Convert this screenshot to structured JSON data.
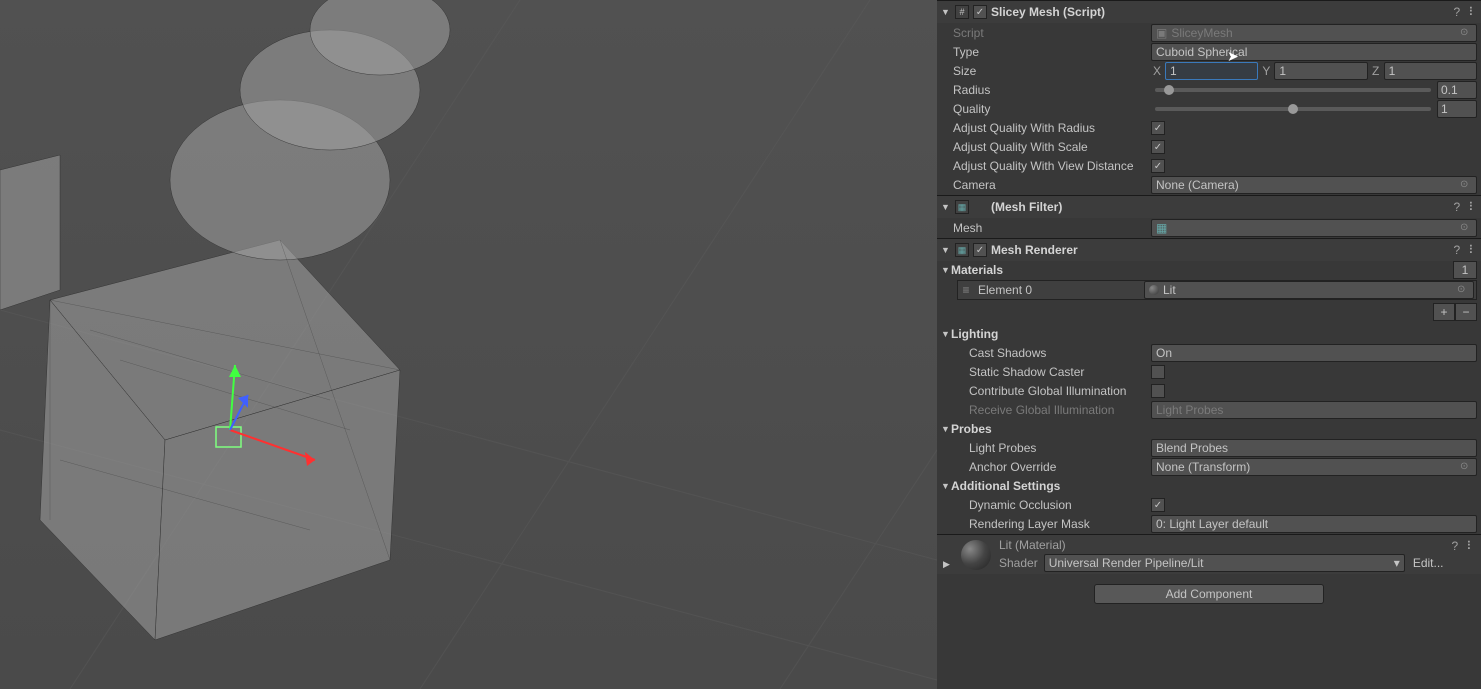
{
  "sliceyMesh": {
    "title": "Slicey Mesh (Script)",
    "scriptLabel": "Script",
    "scriptValue": "SliceyMesh",
    "typeLabel": "Type",
    "typeValue": "Cuboid Spherical",
    "sizeLabel": "Size",
    "sizeX": "1",
    "sizeY": "1",
    "sizeZ": "1",
    "radiusLabel": "Radius",
    "radiusValue": "0.1",
    "qualityLabel": "Quality",
    "qualityValue": "1",
    "adjRadiusLabel": "Adjust Quality With Radius",
    "adjScaleLabel": "Adjust Quality With Scale",
    "adjViewLabel": "Adjust Quality With View Distance",
    "cameraLabel": "Camera",
    "cameraValue": "None (Camera)"
  },
  "meshFilter": {
    "title": "(Mesh Filter)",
    "meshLabel": "Mesh",
    "meshValue": ""
  },
  "meshRenderer": {
    "title": "Mesh Renderer",
    "materialsLabel": "Materials",
    "materialsCount": "1",
    "element0Label": "Element 0",
    "element0Value": "Lit",
    "lightingLabel": "Lighting",
    "castShadowsLabel": "Cast Shadows",
    "castShadowsValue": "On",
    "staticShadowLabel": "Static Shadow Caster",
    "contribGILabel": "Contribute Global Illumination",
    "receiveGILabel": "Receive Global Illumination",
    "receiveGIValue": "Light Probes",
    "probesLabel": "Probes",
    "lightProbesLabel": "Light Probes",
    "lightProbesValue": "Blend Probes",
    "anchorLabel": "Anchor Override",
    "anchorValue": "None (Transform)",
    "addSettingsLabel": "Additional Settings",
    "dynOcclusionLabel": "Dynamic Occlusion",
    "renderLayerLabel": "Rendering Layer Mask",
    "renderLayerValue": "0: Light Layer default"
  },
  "material": {
    "title": "Lit (Material)",
    "shaderLabel": "Shader",
    "shaderValue": "Universal Render Pipeline/Lit",
    "editLabel": "Edit..."
  },
  "addComponent": "Add Component"
}
